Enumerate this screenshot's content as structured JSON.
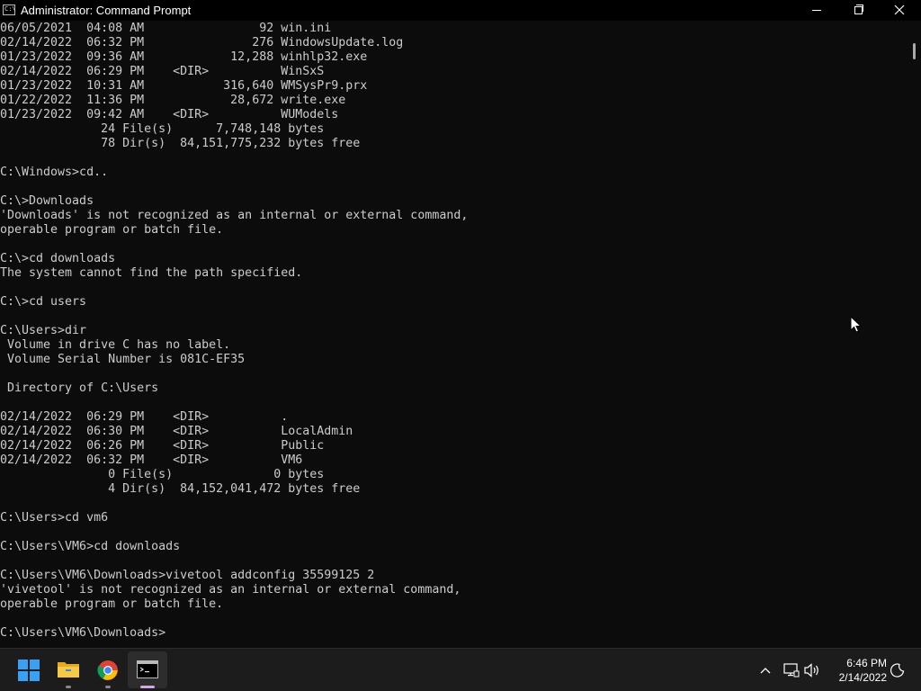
{
  "window": {
    "title": "Administrator: Command Prompt",
    "icon": "cmd-icon",
    "icon_glyph": "C:\\",
    "controls": [
      "minimize-icon",
      "maximize-icon",
      "close-icon"
    ]
  },
  "console": {
    "text_color": "#cccccc",
    "background": "#0c0c0c",
    "lines": [
      "06/05/2021  04:08 AM                92 win.ini",
      "02/14/2022  06:32 PM               276 WindowsUpdate.log",
      "01/23/2022  09:36 AM            12,288 winhlp32.exe",
      "02/14/2022  06:29 PM    <DIR>          WinSxS",
      "01/23/2022  10:31 AM           316,640 WMSysPr9.prx",
      "01/22/2022  11:36 PM            28,672 write.exe",
      "01/23/2022  09:42 AM    <DIR>          WUModels",
      "              24 File(s)      7,748,148 bytes",
      "              78 Dir(s)  84,151,775,232 bytes free",
      "",
      "C:\\Windows>cd..",
      "",
      "C:\\>Downloads",
      "'Downloads' is not recognized as an internal or external command,",
      "operable program or batch file.",
      "",
      "C:\\>cd downloads",
      "The system cannot find the path specified.",
      "",
      "C:\\>cd users",
      "",
      "C:\\Users>dir",
      " Volume in drive C has no label.",
      " Volume Serial Number is 081C-EF35",
      "",
      " Directory of C:\\Users",
      "",
      "02/14/2022  06:29 PM    <DIR>          .",
      "02/14/2022  06:30 PM    <DIR>          LocalAdmin",
      "02/14/2022  06:26 PM    <DIR>          Public",
      "02/14/2022  06:32 PM    <DIR>          VM6",
      "               0 File(s)              0 bytes",
      "               4 Dir(s)  84,152,041,472 bytes free",
      "",
      "C:\\Users>cd vm6",
      "",
      "C:\\Users\\VM6>cd downloads",
      "",
      "C:\\Users\\VM6\\Downloads>vivetool addconfig 35599125 2",
      "'vivetool' is not recognized as an internal or external command,",
      "operable program or batch file.",
      "",
      "C:\\Users\\VM6\\Downloads>"
    ]
  },
  "taskbar": {
    "pinned": [
      {
        "name": "start-button",
        "icon": "windows-logo-icon"
      },
      {
        "name": "file-explorer-button",
        "icon": "folder-icon"
      },
      {
        "name": "chrome-button",
        "icon": "chrome-icon"
      },
      {
        "name": "command-prompt-button",
        "icon": "terminal-icon",
        "active": true
      }
    ],
    "tray": {
      "icons": [
        "chevron-up-icon",
        "network-icon",
        "volume-icon",
        "focus-assist-icon"
      ],
      "time": "6:46 PM",
      "date": "2/14/2022"
    },
    "accent_active": "#cfa8e8"
  }
}
